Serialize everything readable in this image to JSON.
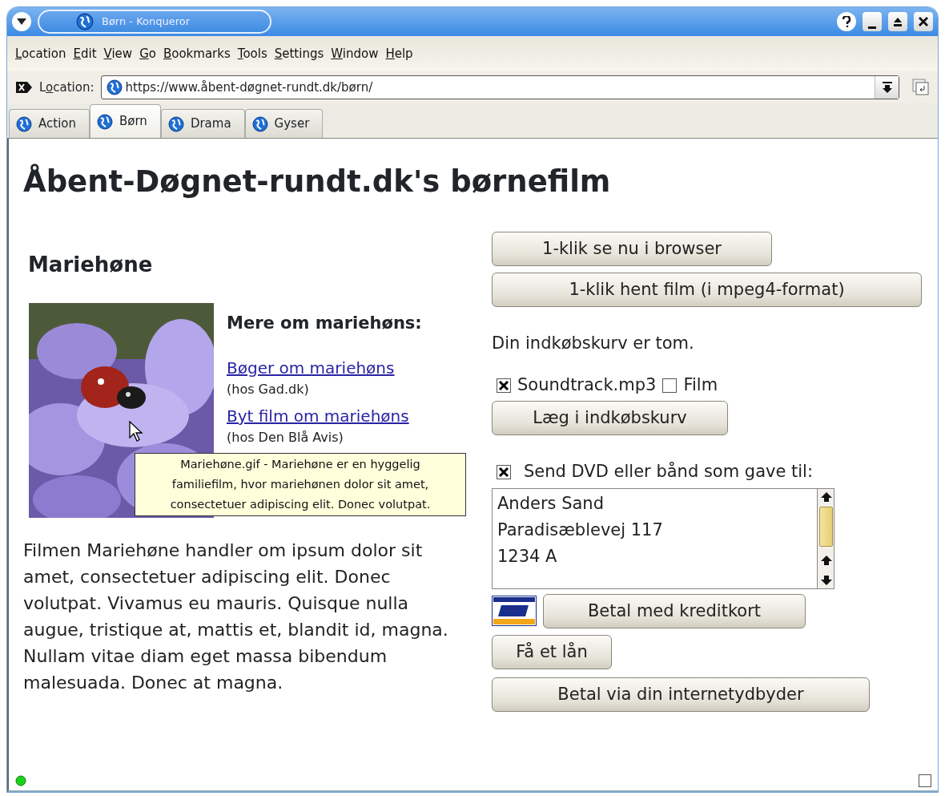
{
  "window": {
    "title": "Børn - Konqueror"
  },
  "menu": [
    {
      "accel": "L",
      "after": "ocation"
    },
    {
      "accel": "E",
      "after": "dit"
    },
    {
      "accel": "V",
      "after": "iew"
    },
    {
      "accel": "G",
      "after": "o"
    },
    {
      "accel": "B",
      "after": "ookmarks"
    },
    {
      "accel": "T",
      "after": "ools"
    },
    {
      "accel": "S",
      "after": "ettings"
    },
    {
      "accel": "W",
      "after": "indow"
    },
    {
      "accel": "H",
      "after": "elp"
    }
  ],
  "location": {
    "label": {
      "before": "L",
      "accel": "o",
      "after": "cation:"
    },
    "url": "https://www.åbent-døgnet-rundt.dk/børn/"
  },
  "tabs": [
    {
      "label": "Action",
      "selected": false
    },
    {
      "label": "Børn",
      "selected": true
    },
    {
      "label": "Drama",
      "selected": false
    },
    {
      "label": "Gyser",
      "selected": false
    }
  ],
  "page": {
    "heading": "Åbent-Døgnet-rundt.dk's børnefilm",
    "film_title": "Mariehøne",
    "more_heading": "Mere om mariehøns:",
    "links": [
      {
        "text": "Bøger om mariehøns",
        "source": "(hos Gad.dk)"
      },
      {
        "text": "Byt film om mariehøns",
        "source": "(hos Den Blå Avis)"
      }
    ],
    "tooltip": "Mariehøne.gif - Mariehøne er en hyggelig familiefilm, hvor mariehønen dolor sit amet, consectetuer adipiscing elit. Donec volutpat.",
    "description": "Filmen Mariehøne handler om ipsum dolor sit amet, consectetuer adipiscing elit. Donec volutpat. Vivamus eu mauris. Quisque nulla augue, tristique at, mattis et, blandit id, magna. Nullam vitae diam eget massa bibendum malesuada. Donec at magna.",
    "watch_buttons": [
      "1-klik se nu i browser",
      "1-klik hent film (i mpeg4-format)"
    ],
    "cart_status": "Din indkøbskurv er tom.",
    "items": [
      {
        "label": "Soundtrack.mp3",
        "checked": true
      },
      {
        "label": "Film",
        "checked": false
      }
    ],
    "add_button": "Læg i indkøbskurv",
    "gift": {
      "label": "Send DVD eller bånd som gave til:",
      "checked": true,
      "address": "Anders Sand\nParadisæblevej 117\n1234 A"
    },
    "card_button": "Betal med kreditkort",
    "loan_button": "Få et lån",
    "isp_button": "Betal via din internetydbyder"
  }
}
